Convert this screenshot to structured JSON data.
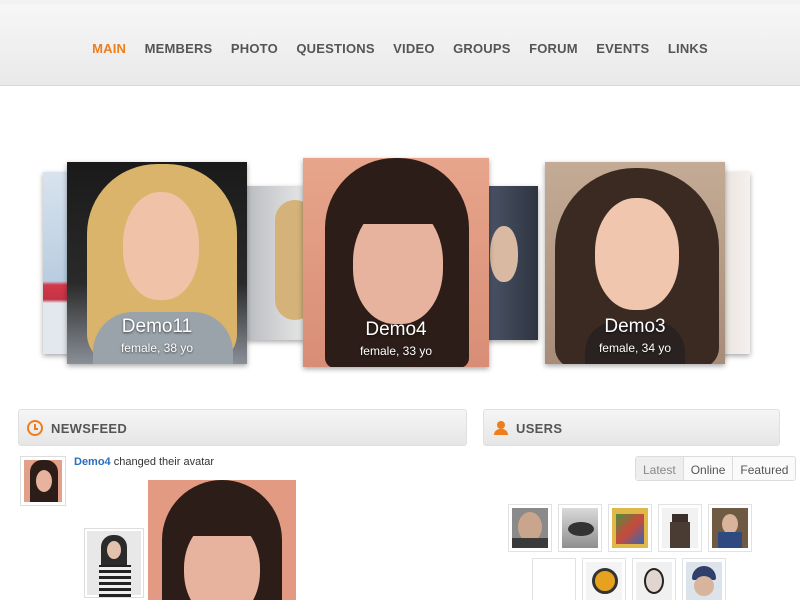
{
  "nav": {
    "items": [
      {
        "label": "MAIN",
        "active": true
      },
      {
        "label": "MEMBERS"
      },
      {
        "label": "PHOTO"
      },
      {
        "label": "QUESTIONS"
      },
      {
        "label": "VIDEO"
      },
      {
        "label": "GROUPS"
      },
      {
        "label": "FORUM"
      },
      {
        "label": "EVENTS"
      },
      {
        "label": "LINKS"
      }
    ]
  },
  "carousel": {
    "cards": [
      {
        "name": "Demo11",
        "info": "female, 38 yo"
      },
      {
        "name": "Demo4",
        "info": "female, 33 yo"
      },
      {
        "name": "Demo3",
        "info": "female, 34 yo"
      }
    ]
  },
  "newsfeed": {
    "title": "NEWSFEED",
    "entry_user": "Demo4",
    "entry_text": " changed their avatar"
  },
  "users": {
    "title": "USERS",
    "tabs": [
      "Latest",
      "Online",
      "Featured"
    ]
  },
  "colors": {
    "accent": "#ef7d1b",
    "link": "#2a6ebd"
  }
}
